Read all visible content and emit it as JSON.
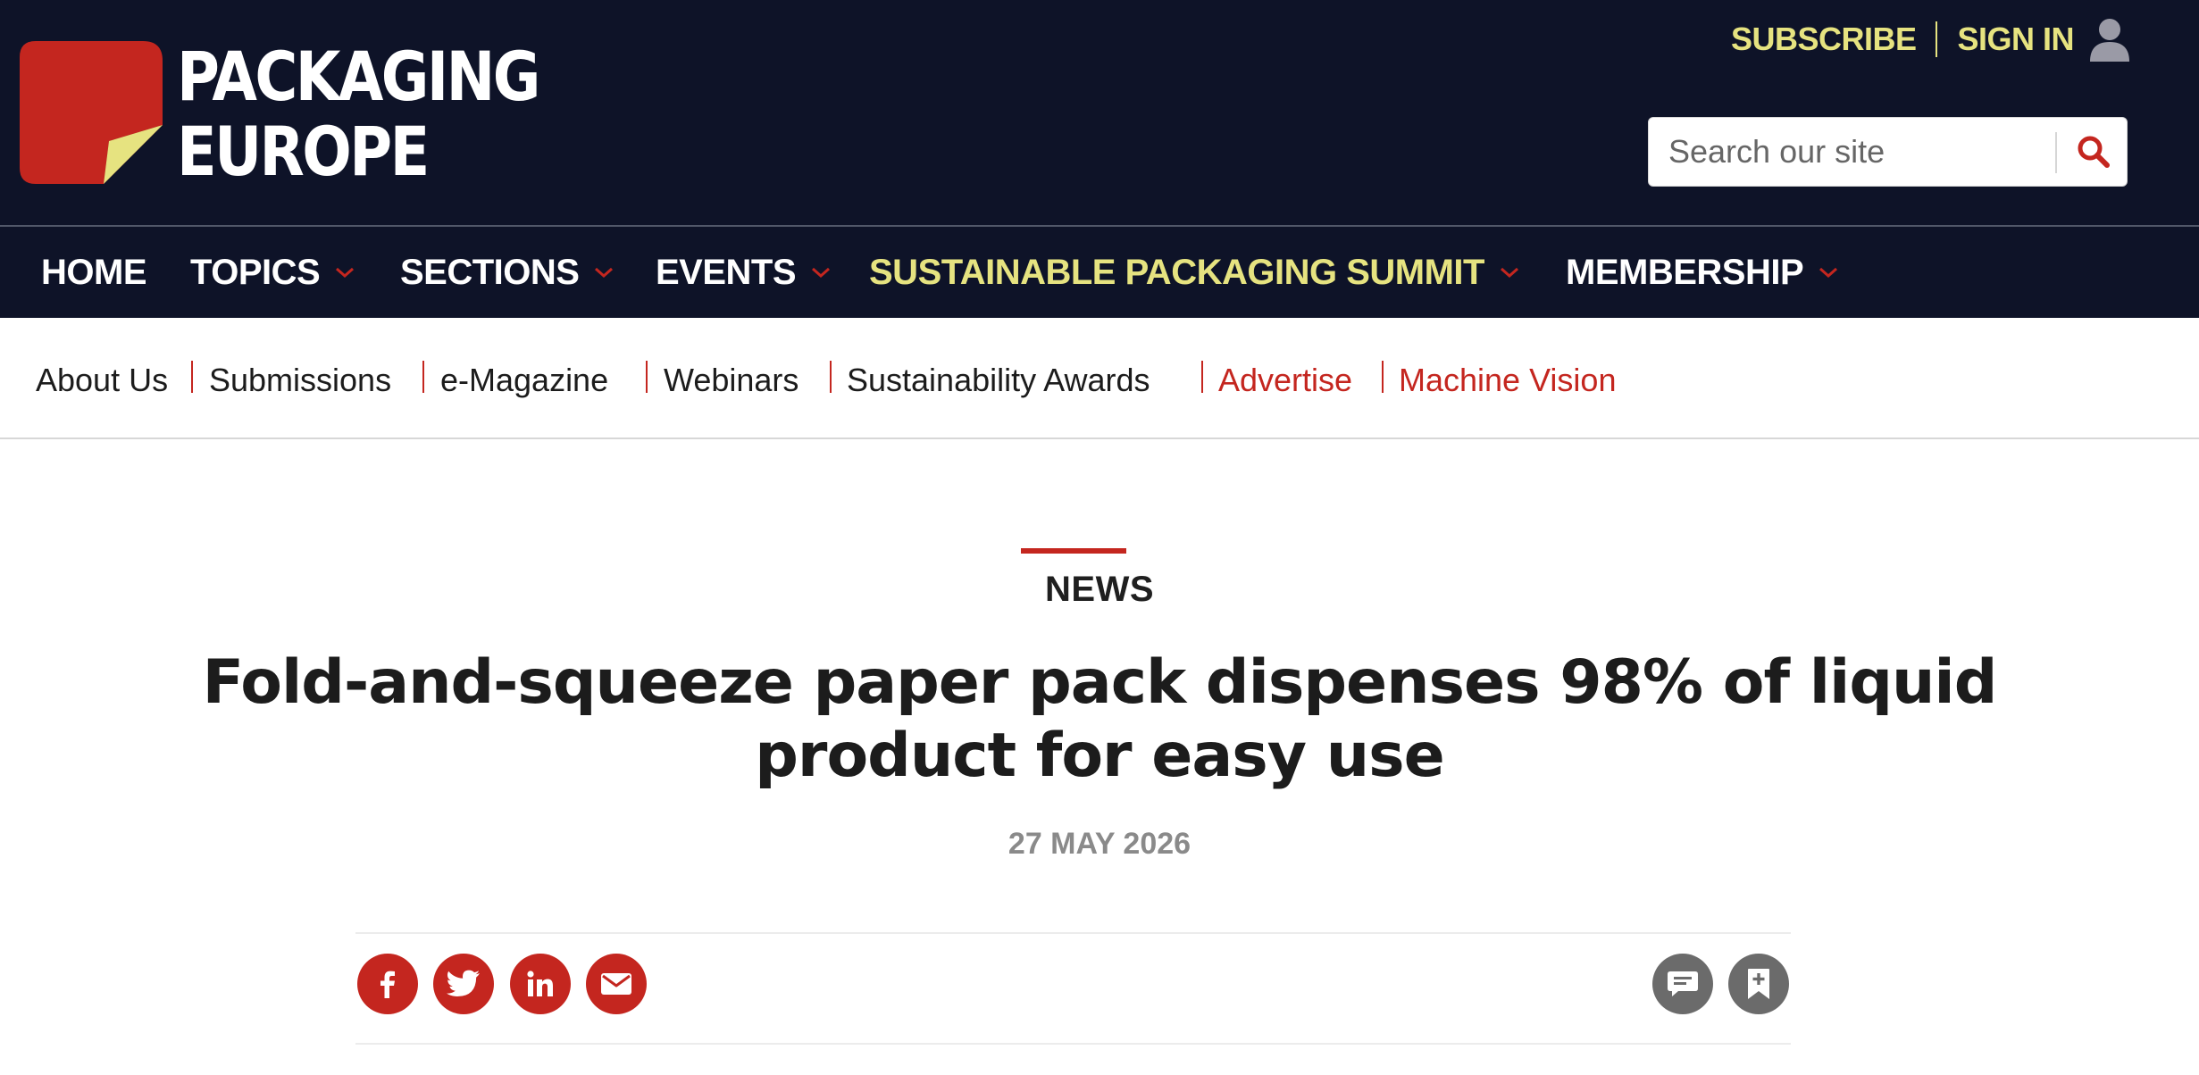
{
  "brand": {
    "name_line1": "PACKAGING",
    "name_line2": "EUROPE",
    "colors": {
      "navy": "#0e1328",
      "red": "#c4261f",
      "yellow": "#e6e380"
    }
  },
  "top_links": {
    "subscribe": "SUBSCRIBE",
    "sign_in": "SIGN IN",
    "user_icon": "user-icon"
  },
  "search": {
    "placeholder": "Search our site",
    "icon": "search-icon"
  },
  "main_nav": [
    {
      "label": "HOME",
      "has_dropdown": false
    },
    {
      "label": "TOPICS",
      "has_dropdown": true
    },
    {
      "label": "SECTIONS",
      "has_dropdown": true
    },
    {
      "label": "EVENTS",
      "has_dropdown": true
    },
    {
      "label": "SUSTAINABLE PACKAGING SUMMIT",
      "has_dropdown": true
    },
    {
      "label": "MEMBERSHIP",
      "has_dropdown": true
    }
  ],
  "sub_nav": [
    {
      "label": "About Us"
    },
    {
      "label": "Submissions"
    },
    {
      "label": "e-Magazine"
    },
    {
      "label": "Webinars"
    },
    {
      "label": "Sustainability Awards"
    },
    {
      "label": "Advertise"
    },
    {
      "label": "Machine Vision"
    }
  ],
  "article": {
    "section": "NEWS",
    "headline": "Fold-and-squeeze paper pack dispenses 98% of liquid product for easy use",
    "date": "27 MAY 2026"
  },
  "share": {
    "icons": [
      "facebook-icon",
      "twitter-icon",
      "linkedin-icon",
      "email-icon"
    ],
    "actions": [
      "comment-icon",
      "bookmark-icon"
    ]
  }
}
